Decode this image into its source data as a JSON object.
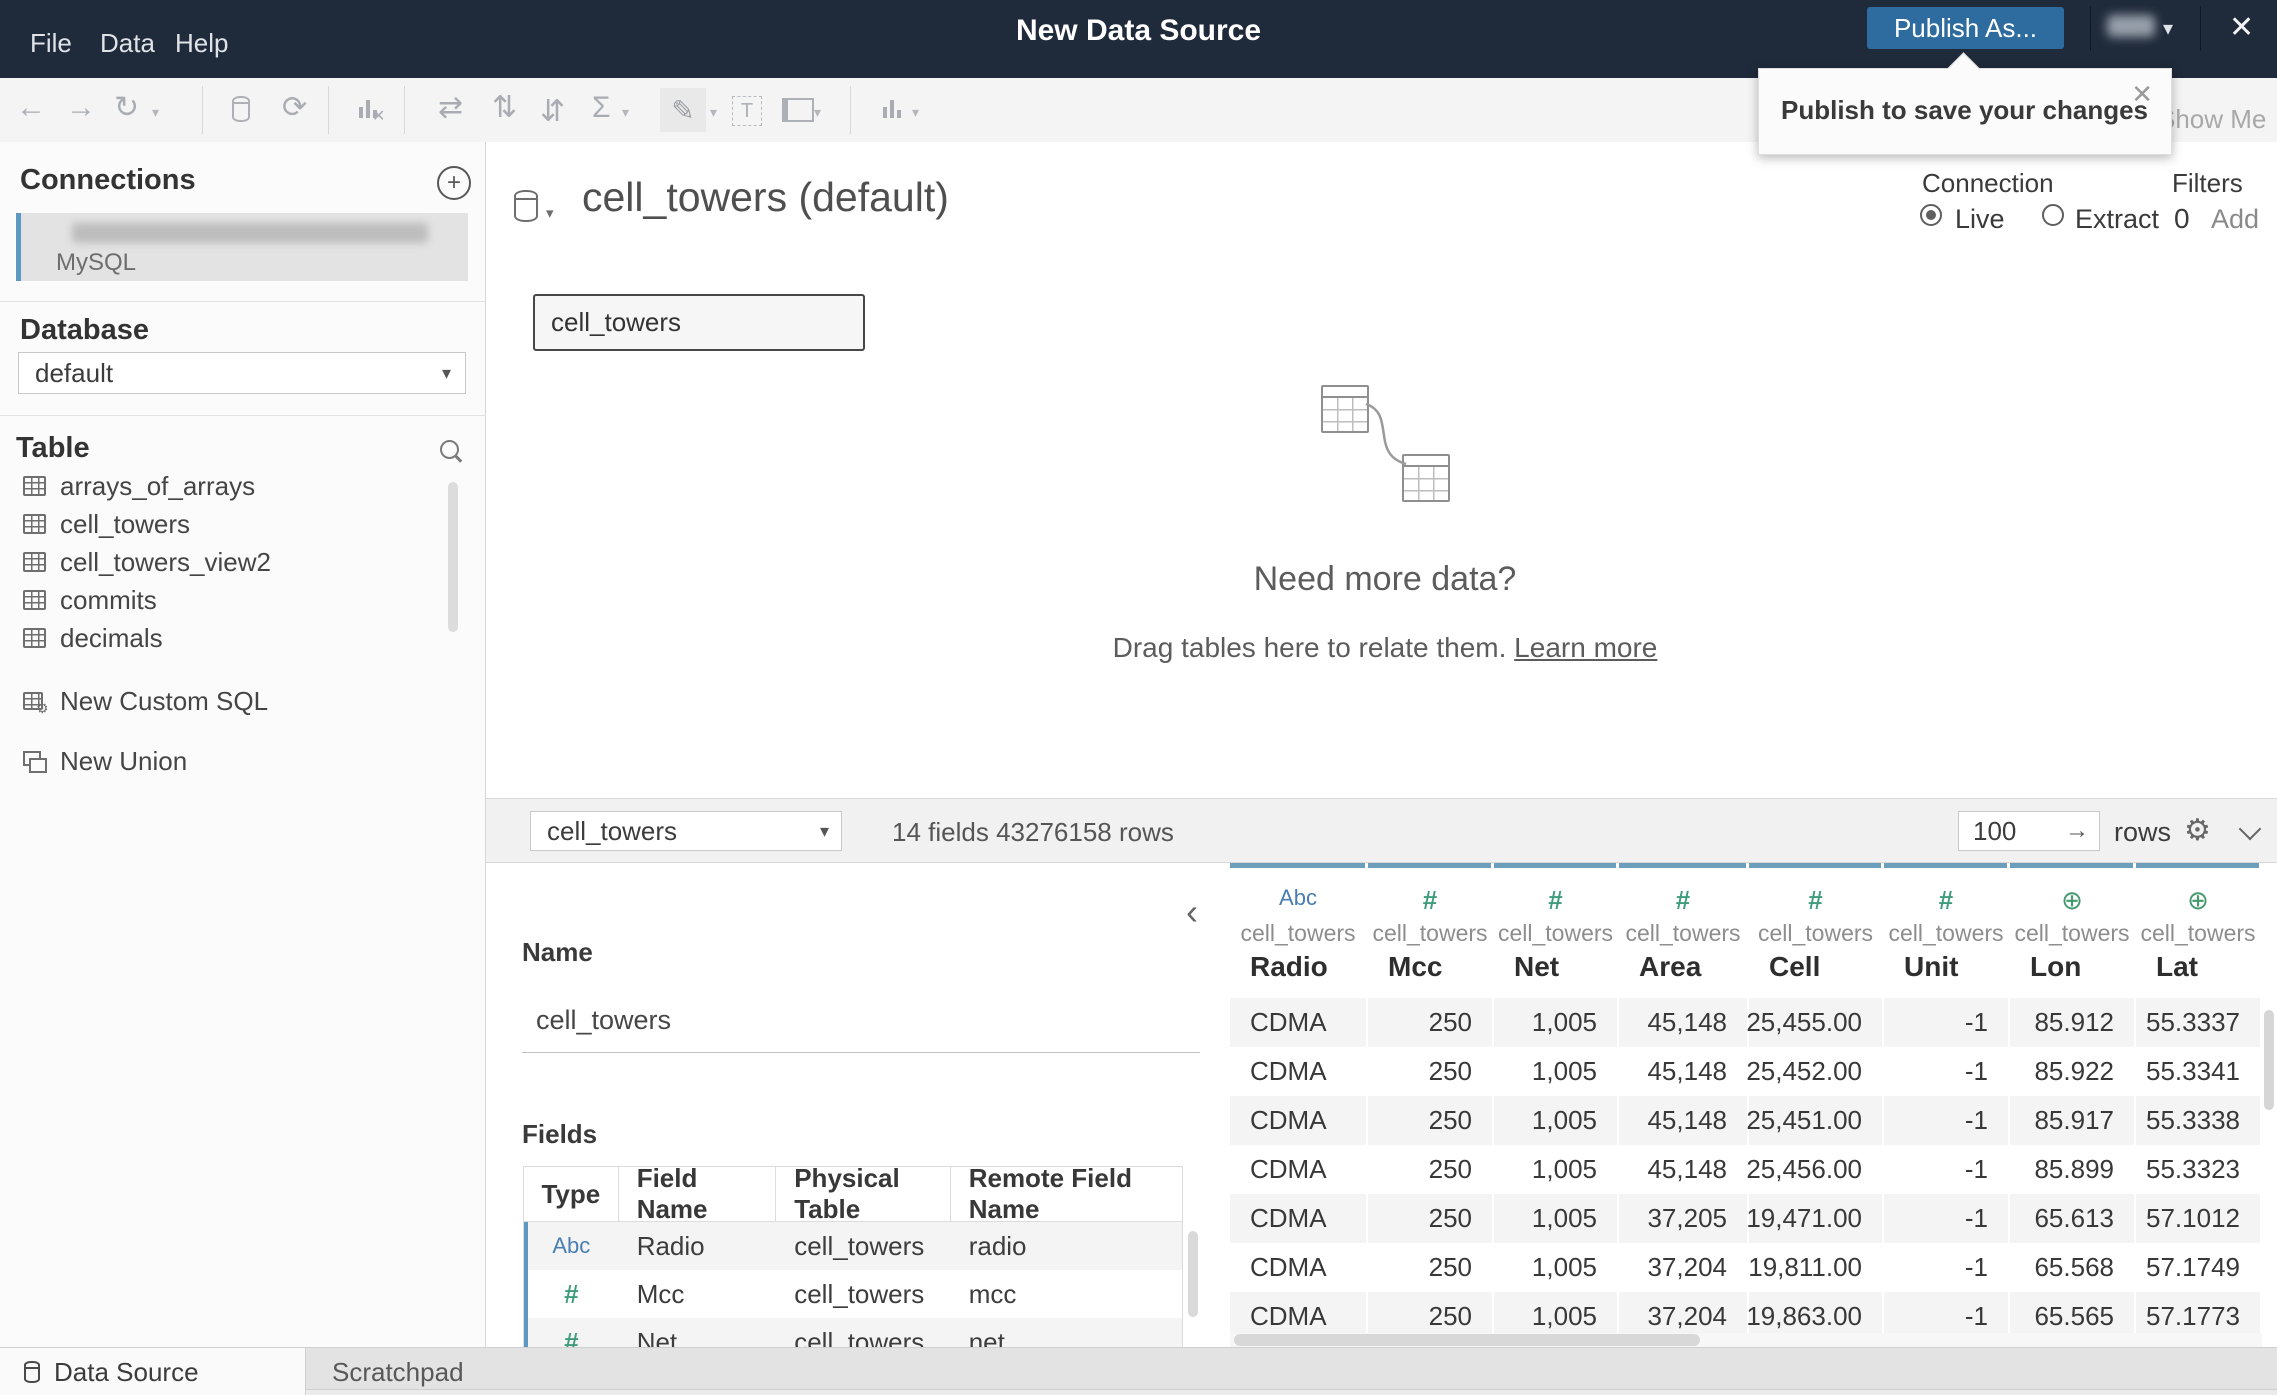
{
  "topbar": {
    "title": "New Data Source",
    "menus": [
      {
        "label": "File"
      },
      {
        "label": "Data"
      },
      {
        "label": "Help"
      }
    ],
    "publish_button_label": "Publish As...",
    "user_caret": "▾",
    "close_icon": "✕"
  },
  "tooltip": {
    "text": "Publish to save your changes",
    "close_icon": "✕"
  },
  "toolbar": {
    "show_me_label": "Show Me",
    "icon_names": [
      "undo-icon",
      "redo-icon",
      "replay-icon",
      "datasource-pause-icon",
      "refresh-icon",
      "cancel-query-icon",
      "swap-axes-icon",
      "sort-ascending-icon",
      "sort-descending-icon",
      "totals-icon",
      "highlight-icon",
      "text-annotation-icon",
      "fit-icon",
      "show-me-icon"
    ]
  },
  "sidebar": {
    "connections": {
      "title": "Connections",
      "add_icon": "+",
      "item": {
        "name_redacted": "",
        "subtitle": "MySQL"
      }
    },
    "database": {
      "title": "Database",
      "selected": "default",
      "caret": "▾"
    },
    "table": {
      "title": "Table",
      "items": [
        "arrays_of_arrays",
        "cell_towers",
        "cell_towers_view2",
        "commits",
        "decimals"
      ],
      "actions": [
        {
          "label": "New Custom SQL"
        },
        {
          "label": "New Union"
        }
      ]
    }
  },
  "canvas": {
    "datasource_title": "cell_towers (default)",
    "title_caret": "▾",
    "connection": {
      "label": "Connection",
      "live_label": "Live",
      "extract_label": "Extract",
      "selected": "Live"
    },
    "filters": {
      "label": "Filters",
      "count": "0",
      "add_label": "Add"
    },
    "node": {
      "label": "cell_towers"
    },
    "empty_state": {
      "heading": "Need more data?",
      "line": "Drag tables here to relate them.",
      "link": "Learn more"
    }
  },
  "preview": {
    "table_select": {
      "value": "cell_towers",
      "caret": "▾"
    },
    "summary": "14 fields 43276158 rows",
    "row_limit": {
      "value": "100",
      "go_icon": "→",
      "rows_label": "rows"
    },
    "gear_icon": "⚙",
    "collapse_icon": "‹",
    "fields_panel": {
      "name_label": "Name",
      "name_value": "cell_towers",
      "fields_label": "Fields",
      "columns": [
        "Type",
        "Field Name",
        "Physical Table",
        "Remote Field Name"
      ],
      "rows": [
        {
          "type_icon": "Abc",
          "field": "Radio",
          "physical": "cell_towers",
          "remote": "radio"
        },
        {
          "type_icon": "#",
          "field": "Mcc",
          "physical": "cell_towers",
          "remote": "mcc"
        },
        {
          "type_icon": "#",
          "field": "Net",
          "physical": "cell_towers",
          "remote": "net"
        }
      ]
    },
    "grid": {
      "columns": [
        {
          "icon": "Abc",
          "icon_name": "abc-icon",
          "table": "cell_towers",
          "name": "Radio"
        },
        {
          "icon": "#",
          "icon_name": "hash-icon",
          "table": "cell_towers",
          "name": "Mcc"
        },
        {
          "icon": "#",
          "icon_name": "hash-icon",
          "table": "cell_towers",
          "name": "Net"
        },
        {
          "icon": "#",
          "icon_name": "hash-icon",
          "table": "cell_towers",
          "name": "Area"
        },
        {
          "icon": "#",
          "icon_name": "hash-icon",
          "table": "cell_towers",
          "name": "Cell"
        },
        {
          "icon": "#",
          "icon_name": "hash-icon",
          "table": "cell_towers",
          "name": "Unit"
        },
        {
          "icon": "⊕",
          "icon_name": "globe-icon",
          "table": "cell_towers",
          "name": "Lon"
        },
        {
          "icon": "⊕",
          "icon_name": "globe-icon",
          "table": "cell_towers",
          "name": "Lat"
        }
      ],
      "rows": [
        [
          "CDMA",
          "250",
          "1,005",
          "45,148",
          "25,455.00",
          "-1",
          "85.912",
          "55.3337"
        ],
        [
          "CDMA",
          "250",
          "1,005",
          "45,148",
          "25,452.00",
          "-1",
          "85.922",
          "55.3341"
        ],
        [
          "CDMA",
          "250",
          "1,005",
          "45,148",
          "25,451.00",
          "-1",
          "85.917",
          "55.3338"
        ],
        [
          "CDMA",
          "250",
          "1,005",
          "45,148",
          "25,456.00",
          "-1",
          "85.899",
          "55.3323"
        ],
        [
          "CDMA",
          "250",
          "1,005",
          "37,205",
          "19,471.00",
          "-1",
          "65.613",
          "57.1012"
        ],
        [
          "CDMA",
          "250",
          "1,005",
          "37,204",
          "19,811.00",
          "-1",
          "65.568",
          "57.1749"
        ],
        [
          "CDMA",
          "250",
          "1,005",
          "37,204",
          "19,863.00",
          "-1",
          "65.565",
          "57.1773"
        ]
      ]
    }
  },
  "tabs": {
    "data_source": "Data Source",
    "scratchpad": "Scratchpad"
  },
  "colors": {
    "topbar_bg": "#1f2a3a",
    "publish_blue": "#2e6b9e",
    "accent_blue": "#6d9ebc",
    "abc_blue": "#4a7eb0",
    "number_green": "#3f9c7c",
    "globe_green": "#44996f"
  }
}
